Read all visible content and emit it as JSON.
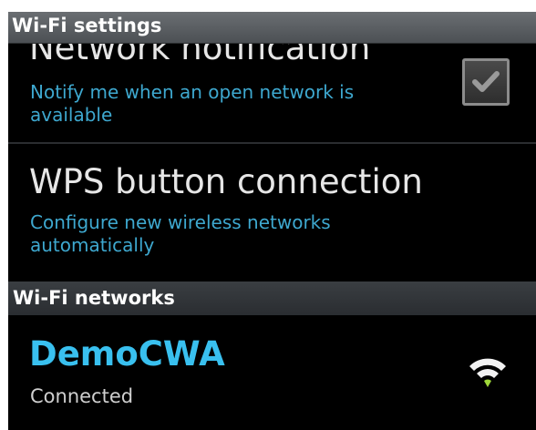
{
  "titlebar": {
    "title": "Wi-Fi settings"
  },
  "settings": {
    "network_notification": {
      "title": "Network notification",
      "description": "Notify me when an open network is available",
      "checked": true
    },
    "wps": {
      "title": "WPS button connection",
      "description": "Configure new wireless networks automatically"
    }
  },
  "networks_section": {
    "header": "Wi-Fi networks",
    "items": [
      {
        "ssid": "DemoCWA",
        "status": "Connected",
        "icon": "wifi-signal-icon"
      }
    ]
  },
  "colors": {
    "accent": "#39c0ef",
    "subtitle": "#3ea8cf",
    "signal": "#9fd83a"
  }
}
